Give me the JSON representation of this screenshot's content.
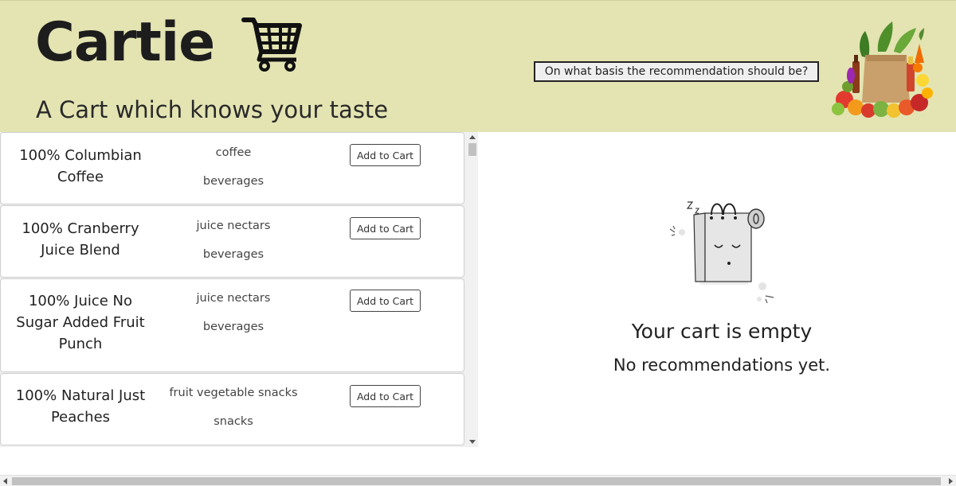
{
  "header": {
    "title": "Cartie",
    "tagline": "A Cart which knows your taste",
    "basis_button": "On what basis the recommendation should be?",
    "background_color": "#e3e4b2"
  },
  "icons": {
    "logo": "shopping-cart-icon",
    "header_image": "grocery-bag-illustration",
    "empty_image": "sleeping-shopping-bag-illustration"
  },
  "products": [
    {
      "name": "100% Columbian Coffee",
      "aisle": "coffee",
      "department": "beverages",
      "button": "Add to Cart"
    },
    {
      "name": "100% Cranberry Juice Blend",
      "aisle": "juice nectars",
      "department": "beverages",
      "button": "Add to Cart"
    },
    {
      "name": "100% Juice No Sugar Added Fruit Punch",
      "aisle": "juice nectars",
      "department": "beverages",
      "button": "Add to Cart"
    },
    {
      "name": "100% Natural Just Peaches",
      "aisle": "fruit vegetable snacks",
      "department": "snacks",
      "button": "Add to Cart"
    }
  ],
  "cart": {
    "empty_title": "Your cart is empty",
    "empty_subtitle": "No recommendations yet."
  }
}
